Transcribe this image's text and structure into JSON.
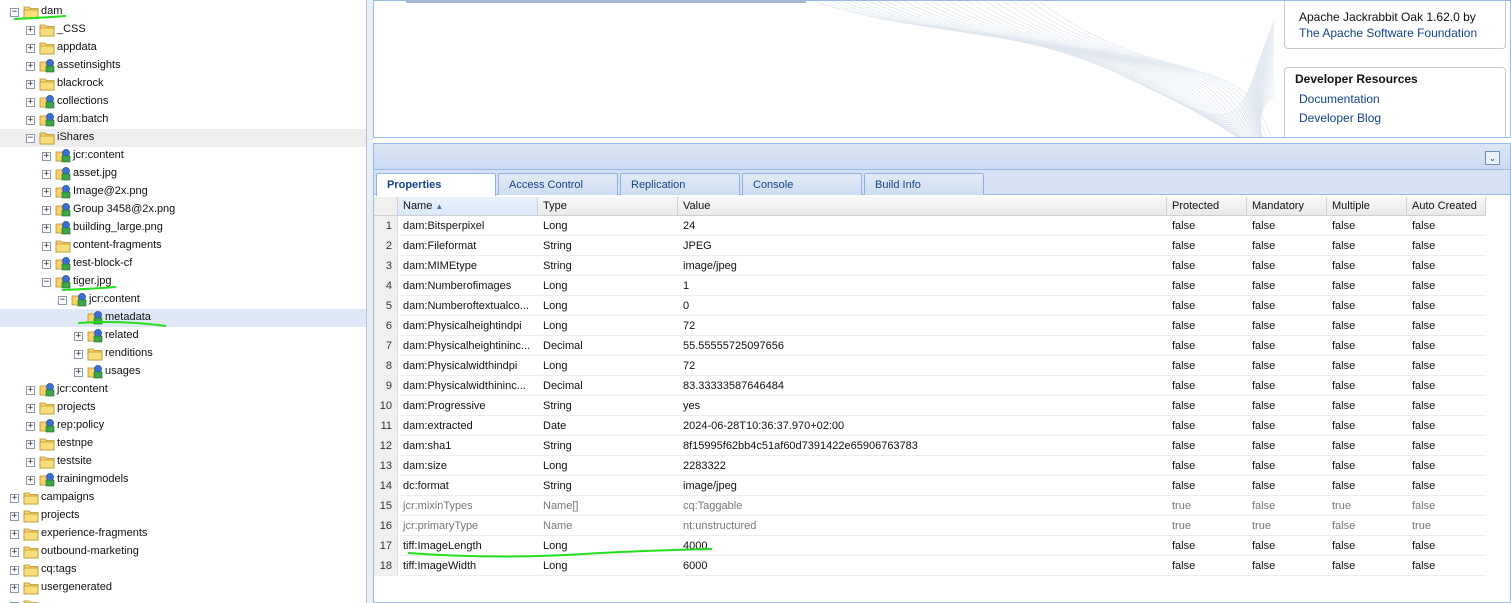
{
  "tree": {
    "items": [
      {
        "label": "dam",
        "icon": "folder",
        "depth": 0,
        "expanded": true,
        "state": "none"
      },
      {
        "label": "_CSS",
        "icon": "folder",
        "depth": 1,
        "expanded": false,
        "state": "none"
      },
      {
        "label": "appdata",
        "icon": "folder",
        "depth": 1,
        "expanded": false,
        "state": "none"
      },
      {
        "label": "assetinsights",
        "icon": "node",
        "depth": 1,
        "expanded": false,
        "state": "none"
      },
      {
        "label": "blackrock",
        "icon": "folder",
        "depth": 1,
        "expanded": false,
        "state": "none"
      },
      {
        "label": "collections",
        "icon": "node",
        "depth": 1,
        "expanded": false,
        "state": "none"
      },
      {
        "label": "dam:batch",
        "icon": "node",
        "depth": 1,
        "expanded": false,
        "state": "none"
      },
      {
        "label": "iShares",
        "icon": "folder",
        "depth": 1,
        "expanded": true,
        "state": "light"
      },
      {
        "label": "jcr:content",
        "icon": "node",
        "depth": 2,
        "expanded": false,
        "state": "none"
      },
      {
        "label": "asset.jpg",
        "icon": "node",
        "depth": 2,
        "expanded": false,
        "state": "none"
      },
      {
        "label": "Image@2x.png",
        "icon": "node",
        "depth": 2,
        "expanded": false,
        "state": "none"
      },
      {
        "label": "Group 3458@2x.png",
        "icon": "node",
        "depth": 2,
        "expanded": false,
        "state": "none"
      },
      {
        "label": "building_large.png",
        "icon": "node",
        "depth": 2,
        "expanded": false,
        "state": "none"
      },
      {
        "label": "content-fragments",
        "icon": "folder",
        "depth": 2,
        "expanded": false,
        "state": "none"
      },
      {
        "label": "test-block-cf",
        "icon": "node",
        "depth": 2,
        "expanded": false,
        "state": "none"
      },
      {
        "label": "tiger.jpg",
        "icon": "node",
        "depth": 2,
        "expanded": true,
        "state": "none"
      },
      {
        "label": "jcr:content",
        "icon": "node",
        "depth": 3,
        "expanded": true,
        "state": "none"
      },
      {
        "label": "metadata",
        "icon": "node",
        "depth": 4,
        "expanded": null,
        "state": "selected"
      },
      {
        "label": "related",
        "icon": "node",
        "depth": 4,
        "expanded": false,
        "state": "none"
      },
      {
        "label": "renditions",
        "icon": "folder",
        "depth": 4,
        "expanded": false,
        "state": "none"
      },
      {
        "label": "usages",
        "icon": "node",
        "depth": 4,
        "expanded": false,
        "state": "none"
      },
      {
        "label": "jcr:content",
        "icon": "node",
        "depth": 1,
        "expanded": false,
        "state": "none"
      },
      {
        "label": "projects",
        "icon": "folder",
        "depth": 1,
        "expanded": false,
        "state": "none"
      },
      {
        "label": "rep:policy",
        "icon": "node",
        "depth": 1,
        "expanded": false,
        "state": "none"
      },
      {
        "label": "testnpe",
        "icon": "folder",
        "depth": 1,
        "expanded": false,
        "state": "none"
      },
      {
        "label": "testsite",
        "icon": "folder",
        "depth": 1,
        "expanded": false,
        "state": "none"
      },
      {
        "label": "trainingmodels",
        "icon": "node",
        "depth": 1,
        "expanded": false,
        "state": "none"
      },
      {
        "label": "campaigns",
        "icon": "folder",
        "depth": 0,
        "expanded": false,
        "state": "none"
      },
      {
        "label": "projects",
        "icon": "folder",
        "depth": 0,
        "expanded": false,
        "state": "none"
      },
      {
        "label": "experience-fragments",
        "icon": "folder",
        "depth": 0,
        "expanded": false,
        "state": "none"
      },
      {
        "label": "outbound-marketing",
        "icon": "folder",
        "depth": 0,
        "expanded": false,
        "state": "none"
      },
      {
        "label": "cq:tags",
        "icon": "folder",
        "depth": 0,
        "expanded": false,
        "state": "none"
      },
      {
        "label": "usergenerated",
        "icon": "folder",
        "depth": 0,
        "expanded": false,
        "state": "none"
      },
      {
        "label": "",
        "icon": "folder",
        "depth": 0,
        "expanded": false,
        "state": "none"
      }
    ]
  },
  "repo_info": {
    "line1": "Apache Jackrabbit Oak 1.62.0 by",
    "link": "The Apache Software Foundation"
  },
  "dev_resources": {
    "title": "Developer Resources",
    "links": [
      "Documentation",
      "Developer Blog"
    ]
  },
  "tabs": [
    {
      "label": "Properties",
      "active": true
    },
    {
      "label": "Access Control",
      "active": false
    },
    {
      "label": "Replication",
      "active": false
    },
    {
      "label": "Console",
      "active": false
    },
    {
      "label": "Build Info",
      "active": false
    }
  ],
  "columns": [
    "Name",
    "Type",
    "Value",
    "Protected",
    "Mandatory",
    "Multiple",
    "Auto Created"
  ],
  "rows": [
    {
      "n": "1",
      "name": "dam:Bitsperpixel",
      "type": "Long",
      "value": "24",
      "protected": "false",
      "mandatory": "false",
      "multiple": "false",
      "auto": "false",
      "dim": false
    },
    {
      "n": "2",
      "name": "dam:Fileformat",
      "type": "String",
      "value": "JPEG",
      "protected": "false",
      "mandatory": "false",
      "multiple": "false",
      "auto": "false",
      "dim": false
    },
    {
      "n": "3",
      "name": "dam:MIMEtype",
      "type": "String",
      "value": "image/jpeg",
      "protected": "false",
      "mandatory": "false",
      "multiple": "false",
      "auto": "false",
      "dim": false
    },
    {
      "n": "4",
      "name": "dam:Numberofimages",
      "type": "Long",
      "value": "1",
      "protected": "false",
      "mandatory": "false",
      "multiple": "false",
      "auto": "false",
      "dim": false
    },
    {
      "n": "5",
      "name": "dam:Numberoftextualco...",
      "type": "Long",
      "value": "0",
      "protected": "false",
      "mandatory": "false",
      "multiple": "false",
      "auto": "false",
      "dim": false
    },
    {
      "n": "6",
      "name": "dam:Physicalheightindpi",
      "type": "Long",
      "value": "72",
      "protected": "false",
      "mandatory": "false",
      "multiple": "false",
      "auto": "false",
      "dim": false
    },
    {
      "n": "7",
      "name": "dam:Physicalheightininc...",
      "type": "Decimal",
      "value": "55.55555725097656",
      "protected": "false",
      "mandatory": "false",
      "multiple": "false",
      "auto": "false",
      "dim": false
    },
    {
      "n": "8",
      "name": "dam:Physicalwidthindpi",
      "type": "Long",
      "value": "72",
      "protected": "false",
      "mandatory": "false",
      "multiple": "false",
      "auto": "false",
      "dim": false
    },
    {
      "n": "9",
      "name": "dam:Physicalwidthininc...",
      "type": "Decimal",
      "value": "83.33333587646484",
      "protected": "false",
      "mandatory": "false",
      "multiple": "false",
      "auto": "false",
      "dim": false
    },
    {
      "n": "10",
      "name": "dam:Progressive",
      "type": "String",
      "value": "yes",
      "protected": "false",
      "mandatory": "false",
      "multiple": "false",
      "auto": "false",
      "dim": false
    },
    {
      "n": "11",
      "name": "dam:extracted",
      "type": "Date",
      "value": "2024-06-28T10:36:37.970+02:00",
      "protected": "false",
      "mandatory": "false",
      "multiple": "false",
      "auto": "false",
      "dim": false
    },
    {
      "n": "12",
      "name": "dam:sha1",
      "type": "String",
      "value": "8f15995f62bb4c51af60d7391422e65906763783",
      "protected": "false",
      "mandatory": "false",
      "multiple": "false",
      "auto": "false",
      "dim": false
    },
    {
      "n": "13",
      "name": "dam:size",
      "type": "Long",
      "value": "2283322",
      "protected": "false",
      "mandatory": "false",
      "multiple": "false",
      "auto": "false",
      "dim": false
    },
    {
      "n": "14",
      "name": "dc:format",
      "type": "String",
      "value": "image/jpeg",
      "protected": "false",
      "mandatory": "false",
      "multiple": "false",
      "auto": "false",
      "dim": false
    },
    {
      "n": "15",
      "name": "jcr:mixinTypes",
      "type": "Name[]",
      "value": "cq:Taggable",
      "protected": "true",
      "mandatory": "false",
      "multiple": "true",
      "auto": "false",
      "dim": true
    },
    {
      "n": "16",
      "name": "jcr:primaryType",
      "type": "Name",
      "value": "nt:unstructured",
      "protected": "true",
      "mandatory": "true",
      "multiple": "false",
      "auto": "true",
      "dim": true
    },
    {
      "n": "17",
      "name": "tiff:ImageLength",
      "type": "Long",
      "value": "4000",
      "protected": "false",
      "mandatory": "false",
      "multiple": "false",
      "auto": "false",
      "dim": false
    },
    {
      "n": "18",
      "name": "tiff:ImageWidth",
      "type": "Long",
      "value": "6000",
      "protected": "false",
      "mandatory": "false",
      "multiple": "false",
      "auto": "false",
      "dim": false
    }
  ],
  "colors": {
    "panel_border": "#99bbe8",
    "link": "#15428b",
    "highlight_marker": "#22e01a",
    "selected_row": "#dfe8f6"
  }
}
